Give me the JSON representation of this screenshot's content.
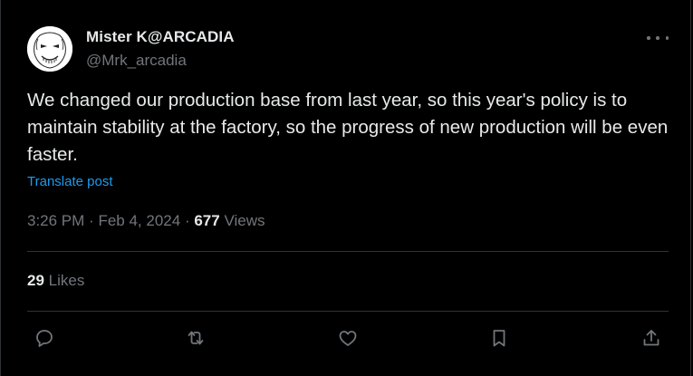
{
  "author": {
    "name": "Mister K@ARCADIA",
    "handle": "@Mrk_arcadia"
  },
  "post": {
    "text": "We changed our production base from last year, so this year's policy is to maintain stability at the factory, so the progress of new production will be even faster.",
    "translate_label": "Translate post"
  },
  "meta": {
    "time": "3:26 PM",
    "separator": "·",
    "date": "Feb 4, 2024",
    "views_count": "677",
    "views_label": "Views"
  },
  "engagement": {
    "likes_count": "29",
    "likes_label": "Likes"
  },
  "actions": [
    "reply-icon",
    "repost-icon",
    "like-icon",
    "bookmark-icon",
    "share-icon"
  ],
  "colors": {
    "background": "#000000",
    "text": "#e7e9ea",
    "secondary": "#71767b",
    "link": "#1d9bf0",
    "divider": "#2f3336"
  }
}
